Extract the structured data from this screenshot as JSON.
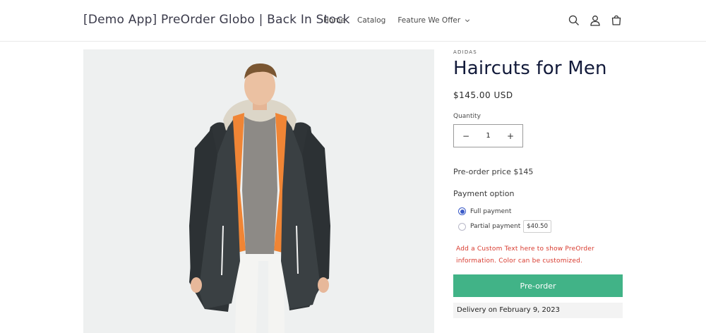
{
  "header": {
    "site_title": "[Demo App] PreOrder Globo | Back In Stock",
    "nav": {
      "home": "Home",
      "catalog": "Catalog",
      "features": "Feature We Offer"
    },
    "icons": [
      "search-icon",
      "account-icon",
      "cart-icon"
    ]
  },
  "product": {
    "vendor": "ADIDAS",
    "title": "Haircuts for Men",
    "price": "$145.00 USD",
    "quantity_label": "Quantity",
    "quantity_value": "1",
    "minus": "−",
    "plus": "+",
    "preorder_price": "Pre-order price $145",
    "payment_option_label": "Payment option",
    "payment_options": [
      {
        "label": "Full payment",
        "selected": true
      },
      {
        "label": "Partial payment",
        "selected": false,
        "amount": "$40.50"
      }
    ],
    "custom_text": "Add a Custom Text here to show PreOrder information. Color can be customized.",
    "preorder_button": "Pre-order",
    "delivery": "Delivery on February 9, 2023"
  },
  "colors": {
    "accent_button": "#41b387",
    "custom_text": "#d83a2e",
    "radio_selected": "#3b5bc8"
  }
}
